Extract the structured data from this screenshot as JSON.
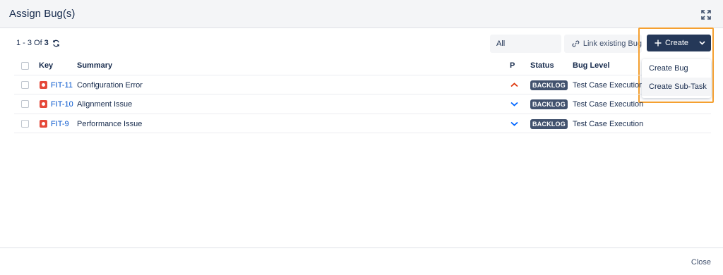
{
  "dialog": {
    "title": "Assign Bug(s)",
    "expand_icon": "expand-icon"
  },
  "pagination": {
    "range": "1 - 3",
    "of_label": "Of",
    "total": "3",
    "refresh_icon": "refresh-icon"
  },
  "toolbar": {
    "filter_value": "All",
    "link_label": "Link existing Bug",
    "link_icon": "link-icon",
    "create_label": "Create",
    "create_icon": "plus-icon"
  },
  "create_menu": {
    "items": [
      {
        "label": "Create Bug"
      },
      {
        "label": "Create Sub-Task"
      }
    ]
  },
  "table": {
    "headers": {
      "key": "Key",
      "summary": "Summary",
      "priority": "P",
      "status": "Status",
      "bug_level": "Bug Level"
    },
    "rows": [
      {
        "key": "FIT-11",
        "summary": "Configuration Error",
        "priority": "high",
        "status": "BACKLOG",
        "bug_level": "Test Case Execution"
      },
      {
        "key": "FIT-10",
        "summary": "Alignment Issue",
        "priority": "low",
        "status": "BACKLOG",
        "bug_level": "Test Case Execution"
      },
      {
        "key": "FIT-9",
        "summary": "Performance Issue",
        "priority": "low",
        "status": "BACKLOG",
        "bug_level": "Test Case Execution"
      }
    ]
  },
  "footer": {
    "close_label": "Close"
  },
  "colors": {
    "create_button": "#253858",
    "highlight_border": "#f5a030",
    "bug_icon": "#e5493a",
    "priority_high": "#de350b",
    "priority_low": "#0065ff",
    "link": "#0052cc"
  }
}
